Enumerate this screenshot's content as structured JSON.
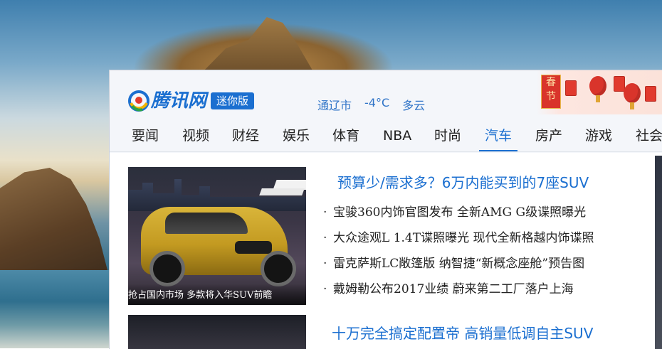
{
  "logo": {
    "brand": "腾讯网",
    "edition": "迷你版"
  },
  "weather": {
    "city": "通辽市",
    "temperature": "-4°C",
    "condition": "多云"
  },
  "festival": {
    "tag": "春节"
  },
  "nav": {
    "items": [
      "要闻",
      "视频",
      "财经",
      "娱乐",
      "体育",
      "NBA",
      "时尚",
      "汽车",
      "房产",
      "游戏",
      "社会"
    ],
    "active": "汽车"
  },
  "featured": {
    "image_caption": "抢占国内市场 多款将入华SUV前瞻",
    "headline": "预算少/需求多？6万内能买到的7座SUV",
    "items": [
      "宝骏360内饰官图发布 全新AMG G级谍照曝光",
      "大众途观L 1.4T谍照曝光 现代全新格越内饰谍照",
      "雷克萨斯LC敞篷版 纳智捷“新概念座舱”预告图",
      "戴姆勒公布2017业绩 蔚来第二工厂落户上海"
    ]
  },
  "second": {
    "headline": "十万完全搞定配置帝 高销量低调自主SUV"
  },
  "colors": {
    "brand_blue": "#1b6fd0",
    "festival_red": "#d9342b"
  }
}
